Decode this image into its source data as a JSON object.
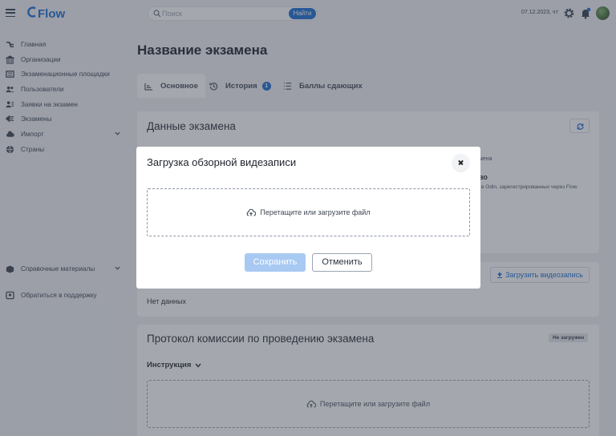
{
  "header": {
    "logo_text": "Flow",
    "search": {
      "placeholder": "Поиск",
      "button_label": "Найти"
    },
    "date_text": "07.12.2023, чт",
    "icons": [
      "menu-icon",
      "search-icon",
      "gear-icon",
      "bell-icon"
    ],
    "colors": {
      "brand": "#1c6fd1",
      "notification_dot": "#1c6fd1"
    }
  },
  "sidebar": {
    "items": [
      {
        "label": "Главная",
        "icon": "home-flow-icon"
      },
      {
        "label": "Организации",
        "icon": "bank-icon"
      },
      {
        "label": "Экзаменационные площадки",
        "icon": "building-icon"
      },
      {
        "label": "Пользователи",
        "icon": "users-icon"
      },
      {
        "label": "Заявки на экзамен",
        "icon": "request-icon"
      },
      {
        "label": "Экзамены",
        "icon": "exam-icon"
      },
      {
        "label": "Импорт",
        "icon": "cloud-icon",
        "has_dropdown": true
      },
      {
        "label": "Страны",
        "icon": "globe-icon"
      }
    ],
    "bottom_items": [
      {
        "label": "Справочные материалы",
        "icon": "box-icon",
        "has_dropdown": true
      },
      {
        "label": "Обратиться в поддержку",
        "icon": "support-icon"
      }
    ]
  },
  "main": {
    "page_title": "Название экзамена",
    "tabs": [
      {
        "label": "Основное",
        "active": true
      },
      {
        "label": "История",
        "badge": "1"
      },
      {
        "label": "Баллы сдающих"
      }
    ],
    "exam_card": {
      "title": "Данные экзамена",
      "partial_text_1": "мена",
      "partial_text_2": "во",
      "partial_text_3": "в Odin, зарегистрированных через Flow"
    },
    "video_card": {
      "upload_button": "Загрузить видеозапись",
      "empty_text": "Нет данных"
    },
    "protocol_card": {
      "title": "Протокол комиссии по проведению экзамена",
      "status_badge": "Не загружен",
      "instruction_label": "Инструкция",
      "drop_text": "Перетащите или загрузите файл"
    }
  },
  "modal": {
    "title": "Загрузка обзорной видезаписи",
    "drop_text": "Перетащите или загрузите файл",
    "save_label": "Сохранить",
    "cancel_label": "Отменить",
    "colors": {
      "save_disabled": "#a8c9f2"
    }
  }
}
